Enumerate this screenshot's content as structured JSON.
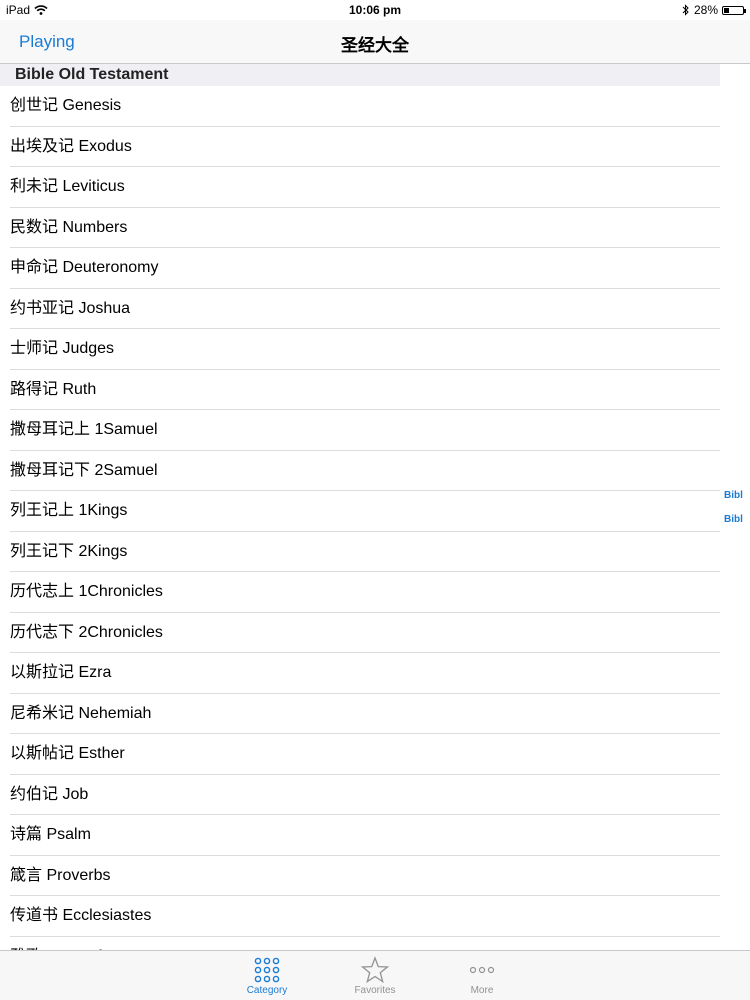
{
  "status_bar": {
    "device": "iPad",
    "time": "10:06 pm",
    "battery_percent": "28%",
    "battery_level": 0.28
  },
  "nav": {
    "back_label": "Playing",
    "title": "圣经大全"
  },
  "section": {
    "header": "Bible Old Testament"
  },
  "books": [
    "创世记  Genesis",
    "出埃及记  Exodus",
    "利未记  Leviticus",
    "民数记  Numbers",
    "申命记  Deuteronomy",
    "约书亚记  Joshua",
    "士师记  Judges",
    "路得记  Ruth",
    "撒母耳记上  1Samuel",
    "撒母耳记下  2Samuel",
    "列王记上  1Kings",
    "列王记下  2Kings",
    "历代志上  1Chronicles",
    "历代志下  2Chronicles",
    "以斯拉记  Ezra",
    "尼希米记  Nehemiah",
    "以斯帖记  Esther",
    "约伯记  Job",
    "诗篇  Psalm",
    "箴言  Proverbs",
    "传道书  Ecclesiastes",
    "雅歌  Song of Songs"
  ],
  "section_index": [
    "Bibl",
    "Bibl"
  ],
  "tabs": [
    {
      "label": "Category",
      "icon": "grid-icon",
      "active": true
    },
    {
      "label": "Favorites",
      "icon": "star-icon",
      "active": false
    },
    {
      "label": "More",
      "icon": "more-dots-icon",
      "active": false
    }
  ],
  "colors": {
    "accent": "#1a7bd5",
    "inactive": "#929292"
  }
}
